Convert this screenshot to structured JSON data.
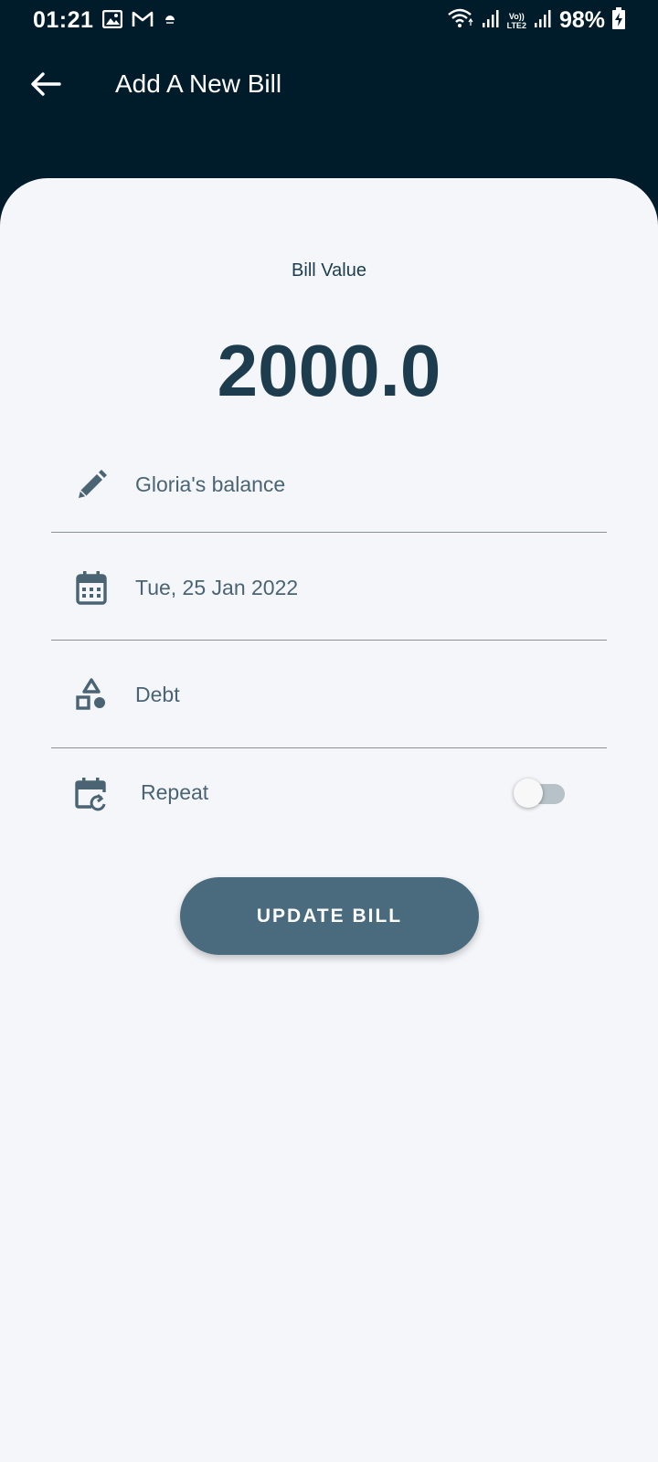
{
  "status_bar": {
    "time": "01:21",
    "left_icons": [
      "image-icon",
      "gmail-icon",
      "weather-icon"
    ],
    "right_icons": [
      "wifi-icon",
      "signal-icon",
      "volte-lte2-icon",
      "signal-icon",
      "battery-charging-icon"
    ],
    "volte_label": "Vo))",
    "lte_label": "LTE2",
    "battery": "98%"
  },
  "app_bar": {
    "back_icon": "arrow-back-icon",
    "title": "Add A New Bill"
  },
  "bill": {
    "label": "Bill Value",
    "value": "2000.0"
  },
  "fields": {
    "name": {
      "icon": "pencil-icon",
      "value": "Gloria's balance"
    },
    "date": {
      "icon": "calendar-icon",
      "value": "Tue, 25 Jan 2022"
    },
    "category": {
      "icon": "shapes-icon",
      "value": "Debt"
    },
    "repeat": {
      "icon": "calendar-repeat-icon",
      "label": "Repeat",
      "enabled": false
    }
  },
  "actions": {
    "update_label": "UPDATE BILL"
  },
  "colors": {
    "header_bg": "#001c2b",
    "sheet_bg": "#f4f6fa",
    "primary_text": "#1d3d4f",
    "field_text": "#4a6474",
    "button_bg": "#4a6b7d"
  }
}
